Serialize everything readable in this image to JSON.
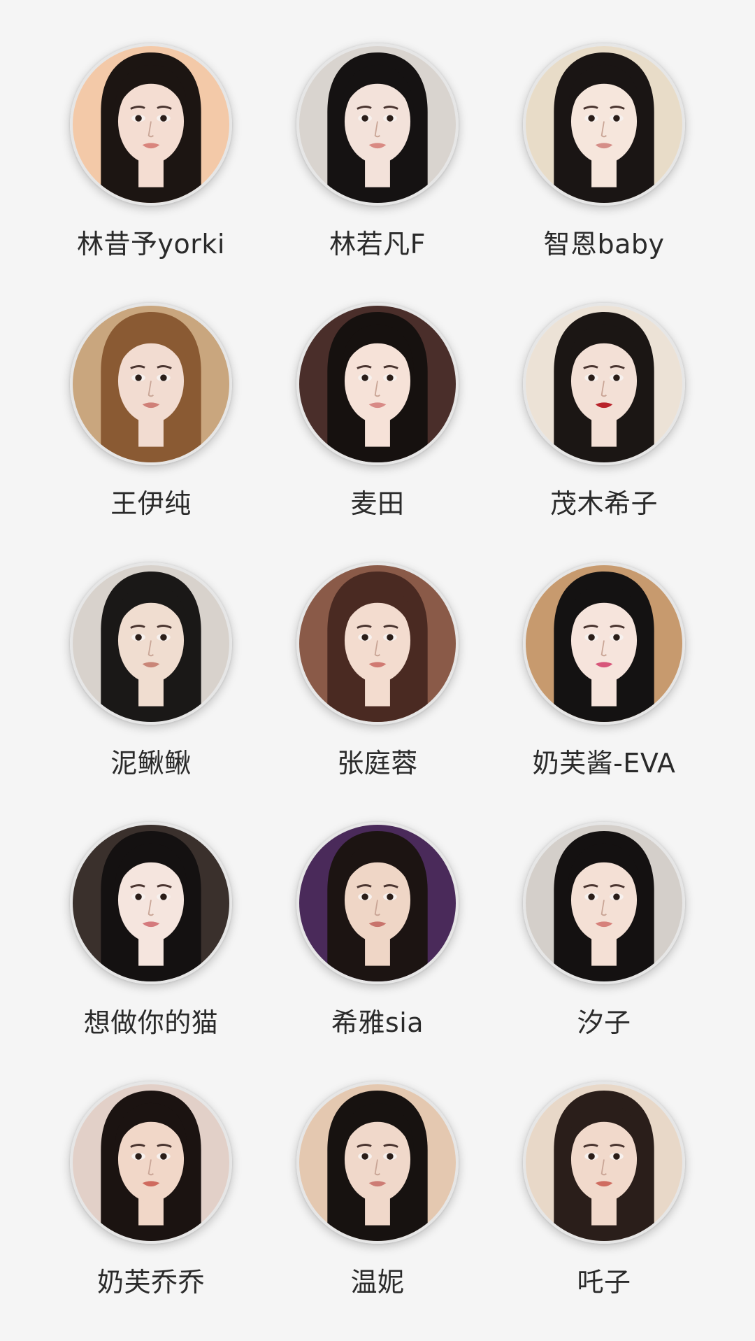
{
  "profiles": [
    {
      "name": "林昔予yorki",
      "hair": "#1c1512",
      "bg": "#f3c9a8",
      "skin": "#f4ddd2",
      "lip": "#d9857d"
    },
    {
      "name": "林若凡F",
      "hair": "#151212",
      "bg": "#d9d4cf",
      "skin": "#f3e2da",
      "lip": "#d98a83"
    },
    {
      "name": "智恩baby",
      "hair": "#1a1514",
      "bg": "#e8dcc8",
      "skin": "#f6e6dc",
      "lip": "#d58e88"
    },
    {
      "name": "王伊纯",
      "hair": "#8a5a33",
      "bg": "#c9a67e",
      "skin": "#f2dcd1",
      "lip": "#cf8078"
    },
    {
      "name": "麦田",
      "hair": "#16110f",
      "bg": "#4a2e2a",
      "skin": "#f6e2d8",
      "lip": "#d88a86"
    },
    {
      "name": "茂木希子",
      "hair": "#1b1614",
      "bg": "#ece2d6",
      "skin": "#f3e0d6",
      "lip": "#b8222a"
    },
    {
      "name": "泥鳅鳅",
      "hair": "#1a1817",
      "bg": "#d8d2cc",
      "skin": "#f0ddd0",
      "lip": "#c98678"
    },
    {
      "name": "张庭蓉",
      "hair": "#4a2a22",
      "bg": "#8a5a48",
      "skin": "#f3dccf",
      "lip": "#d07a72"
    },
    {
      "name": "奶芙酱-EVA",
      "hair": "#141212",
      "bg": "#c79a6e",
      "skin": "#f6e4dc",
      "lip": "#d7567a"
    },
    {
      "name": "想做你的猫",
      "hair": "#141111",
      "bg": "#3a302c",
      "skin": "#f5e5de",
      "lip": "#d47a7d"
    },
    {
      "name": "希雅sia",
      "hair": "#1c1412",
      "bg": "#4a2a5a",
      "skin": "#efd6c6",
      "lip": "#c8746c"
    },
    {
      "name": "汐子",
      "hair": "#141111",
      "bg": "#d4cfca",
      "skin": "#f4e0d5",
      "lip": "#d6817b"
    },
    {
      "name": "奶芙乔乔",
      "hair": "#1b1311",
      "bg": "#e2d0c8",
      "skin": "#f1d7c8",
      "lip": "#cf6a5e"
    },
    {
      "name": "温妮",
      "hair": "#171210",
      "bg": "#e4c8b0",
      "skin": "#f0d8ca",
      "lip": "#cd7c74"
    },
    {
      "name": "吒子",
      "hair": "#2a1e1a",
      "bg": "#e8d8c8",
      "skin": "#f1d9cb",
      "lip": "#cf6c60"
    }
  ]
}
